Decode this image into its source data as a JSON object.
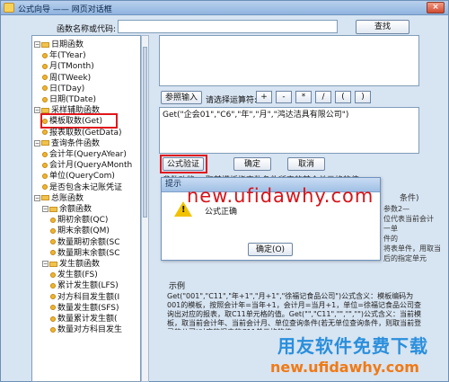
{
  "window": {
    "title": "公式向导 —— 网页对话框",
    "close": "×"
  },
  "search": {
    "label": "函数名称或代码:",
    "button": "查找"
  },
  "tree": [
    {
      "label": "日期函数",
      "level": 0,
      "kind": "group"
    },
    {
      "label": "年(TYear)",
      "level": 1,
      "kind": "leaf"
    },
    {
      "label": "月(TMonth)",
      "level": 1,
      "kind": "leaf"
    },
    {
      "label": "周(TWeek)",
      "level": 1,
      "kind": "leaf"
    },
    {
      "label": "日(TDay)",
      "level": 1,
      "kind": "leaf"
    },
    {
      "label": "日期(TDate)",
      "level": 1,
      "kind": "leaf"
    },
    {
      "label": "采样辅助函数",
      "level": 0,
      "kind": "group"
    },
    {
      "label": "模板取数(Get)",
      "level": 1,
      "kind": "leaf"
    },
    {
      "label": "报表取数(GetData)",
      "level": 1,
      "kind": "leaf"
    },
    {
      "label": "查询条件函数",
      "level": 0,
      "kind": "group"
    },
    {
      "label": "会计年(QueryAYear)",
      "level": 1,
      "kind": "leaf"
    },
    {
      "label": "会计月(QueryAMonth",
      "level": 1,
      "kind": "leaf"
    },
    {
      "label": "单位(QueryCom)",
      "level": 1,
      "kind": "leaf"
    },
    {
      "label": "是否包含未记账凭证",
      "level": 1,
      "kind": "leaf"
    },
    {
      "label": "总账函数",
      "level": 0,
      "kind": "group"
    },
    {
      "label": "余额函数",
      "level": 1,
      "kind": "group"
    },
    {
      "label": "期初余额(QC)",
      "level": 2,
      "kind": "leaf"
    },
    {
      "label": "期末余额(QM)",
      "level": 2,
      "kind": "leaf"
    },
    {
      "label": "数量期初余额(SC",
      "level": 2,
      "kind": "leaf"
    },
    {
      "label": "数量期末余额(SC",
      "level": 2,
      "kind": "leaf"
    },
    {
      "label": "发生额函数",
      "level": 1,
      "kind": "group"
    },
    {
      "label": "发生额(FS)",
      "level": 2,
      "kind": "leaf"
    },
    {
      "label": "累计发生额(LFS)",
      "level": 2,
      "kind": "leaf"
    },
    {
      "label": "对方科目发生额(I",
      "level": 2,
      "kind": "leaf"
    },
    {
      "label": "数量发生额(SFS)",
      "level": 2,
      "kind": "leaf"
    },
    {
      "label": "数量累计发生额(",
      "level": 2,
      "kind": "leaf"
    },
    {
      "label": "数量对方科目发生",
      "level": 2,
      "kind": "leaf"
    }
  ],
  "toolbar": {
    "param_button": "参照输入",
    "op_label": "请选择运算符:",
    "operators": [
      "+",
      "-",
      "*",
      "/",
      "(",
      ")"
    ]
  },
  "formula": {
    "value": "Get(\"企会01\",\"C6\",\"年\",\"月\",\"鸿达洁具有限公司\")"
  },
  "actions": {
    "verify": "公式验证",
    "ok": "确定",
    "cancel": "取消"
  },
  "hint": {
    "partial": "参数功能：  取某模板指定数条件所定的某个单元格的值",
    "side_lines": [
      "参数2—",
      "位代表当前会计",
      "一单",
      "件的",
      "将表单件，用取当",
      "后的指定单元"
    ],
    "side_lines_top": [
      "条件)"
    ]
  },
  "example": {
    "title": "示例",
    "text": "Get(\"001\",\"C11\",\"年+1\",\"月+1\",\"徐福记食品公司\")公式含义：模板编码为001的模板，按照会计年=当年+1，会计月=当月+1，单位=徐福记食品公司查询出对应的报表，取C11单元格的值。Get(\"\",\"C11\",\"\",\"\",\"\")公式含义：当前模板，取当前会计年、当前会计月、单位查询条件(若无单位查询条件，则取当前登录的公司)对应的报表的C11单元格的值"
  },
  "dialog": {
    "title": "提示",
    "message": "公式正确",
    "ok": "确定(O)"
  },
  "watermark": {
    "url1": "new.ufidawhy.com",
    "brand": "用友软件免费下载",
    "url2": "new.ufidawhy.com"
  },
  "colors": {
    "red": "#e1161c",
    "watermark_red": "#d8131a",
    "watermark_blue": "#2a8fdc"
  }
}
